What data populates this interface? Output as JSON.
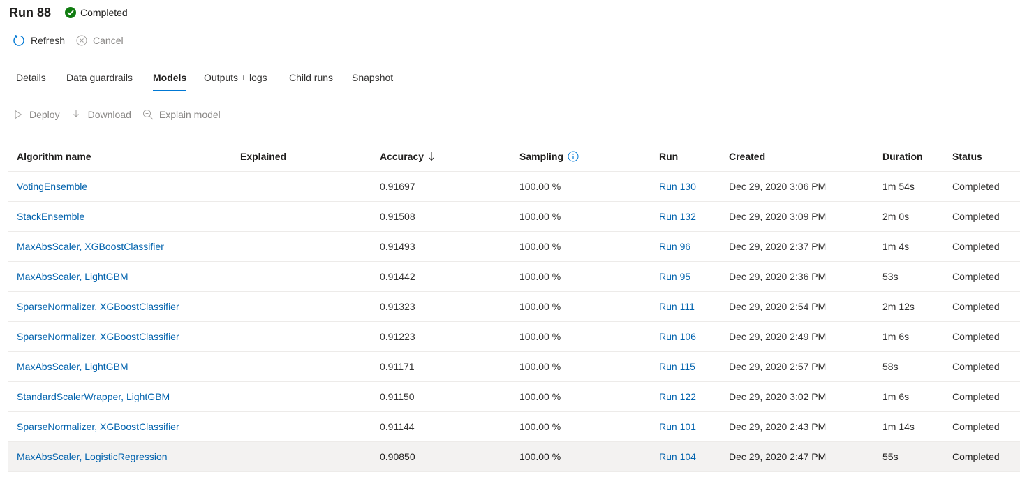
{
  "header": {
    "title": "Run 88",
    "status": "Completed",
    "status_color": "#107c10"
  },
  "commands": {
    "refresh": "Refresh",
    "cancel": "Cancel"
  },
  "tabs": [
    {
      "label": "Details"
    },
    {
      "label": "Data guardrails"
    },
    {
      "label": "Models",
      "active": true
    },
    {
      "label": "Outputs + logs"
    },
    {
      "label": "Child runs"
    },
    {
      "label": "Snapshot"
    }
  ],
  "toolbar": {
    "deploy": "Deploy",
    "download": "Download",
    "explain": "Explain model"
  },
  "table": {
    "columns": {
      "algorithm": "Algorithm name",
      "explained": "Explained",
      "accuracy": "Accuracy",
      "sampling": "Sampling",
      "run": "Run",
      "created": "Created",
      "duration": "Duration",
      "status": "Status"
    },
    "sort": {
      "column": "accuracy",
      "direction": "descending"
    },
    "rows": [
      {
        "algorithm": "VotingEnsemble",
        "explained": "",
        "accuracy": "0.91697",
        "sampling": "100.00 %",
        "run": "Run 130",
        "created": "Dec 29, 2020 3:06 PM",
        "duration": "1m 54s",
        "status": "Completed"
      },
      {
        "algorithm": "StackEnsemble",
        "explained": "",
        "accuracy": "0.91508",
        "sampling": "100.00 %",
        "run": "Run 132",
        "created": "Dec 29, 2020 3:09 PM",
        "duration": "2m 0s",
        "status": "Completed"
      },
      {
        "algorithm": "MaxAbsScaler, XGBoostClassifier",
        "explained": "",
        "accuracy": "0.91493",
        "sampling": "100.00 %",
        "run": "Run 96",
        "created": "Dec 29, 2020 2:37 PM",
        "duration": "1m 4s",
        "status": "Completed"
      },
      {
        "algorithm": "MaxAbsScaler, LightGBM",
        "explained": "",
        "accuracy": "0.91442",
        "sampling": "100.00 %",
        "run": "Run 95",
        "created": "Dec 29, 2020 2:36 PM",
        "duration": "53s",
        "status": "Completed"
      },
      {
        "algorithm": "SparseNormalizer, XGBoostClassifier",
        "explained": "",
        "accuracy": "0.91323",
        "sampling": "100.00 %",
        "run": "Run 111",
        "created": "Dec 29, 2020 2:54 PM",
        "duration": "2m 12s",
        "status": "Completed"
      },
      {
        "algorithm": "SparseNormalizer, XGBoostClassifier",
        "explained": "",
        "accuracy": "0.91223",
        "sampling": "100.00 %",
        "run": "Run 106",
        "created": "Dec 29, 2020 2:49 PM",
        "duration": "1m 6s",
        "status": "Completed"
      },
      {
        "algorithm": "MaxAbsScaler, LightGBM",
        "explained": "",
        "accuracy": "0.91171",
        "sampling": "100.00 %",
        "run": "Run 115",
        "created": "Dec 29, 2020 2:57 PM",
        "duration": "58s",
        "status": "Completed"
      },
      {
        "algorithm": "StandardScalerWrapper, LightGBM",
        "explained": "",
        "accuracy": "0.91150",
        "sampling": "100.00 %",
        "run": "Run 122",
        "created": "Dec 29, 2020 3:02 PM",
        "duration": "1m 6s",
        "status": "Completed"
      },
      {
        "algorithm": "SparseNormalizer, XGBoostClassifier",
        "explained": "",
        "accuracy": "0.91144",
        "sampling": "100.00 %",
        "run": "Run 101",
        "created": "Dec 29, 2020 2:43 PM",
        "duration": "1m 14s",
        "status": "Completed"
      },
      {
        "algorithm": "MaxAbsScaler, LogisticRegression",
        "explained": "",
        "accuracy": "0.90850",
        "sampling": "100.00 %",
        "run": "Run 104",
        "created": "Dec 29, 2020 2:47 PM",
        "duration": "55s",
        "status": "Completed",
        "selected": true
      }
    ]
  },
  "colors": {
    "accent": "#0078d4",
    "link": "#0062ad",
    "success": "#107c10",
    "disabled": "#8a8886"
  },
  "icons": {
    "status": "check-circle-icon",
    "refresh": "refresh-icon",
    "cancel": "cancel-icon",
    "deploy": "play-icon",
    "download": "download-icon",
    "explain": "search-zoom-icon",
    "sort": "sort-down-arrow-icon",
    "info": "info-icon"
  }
}
